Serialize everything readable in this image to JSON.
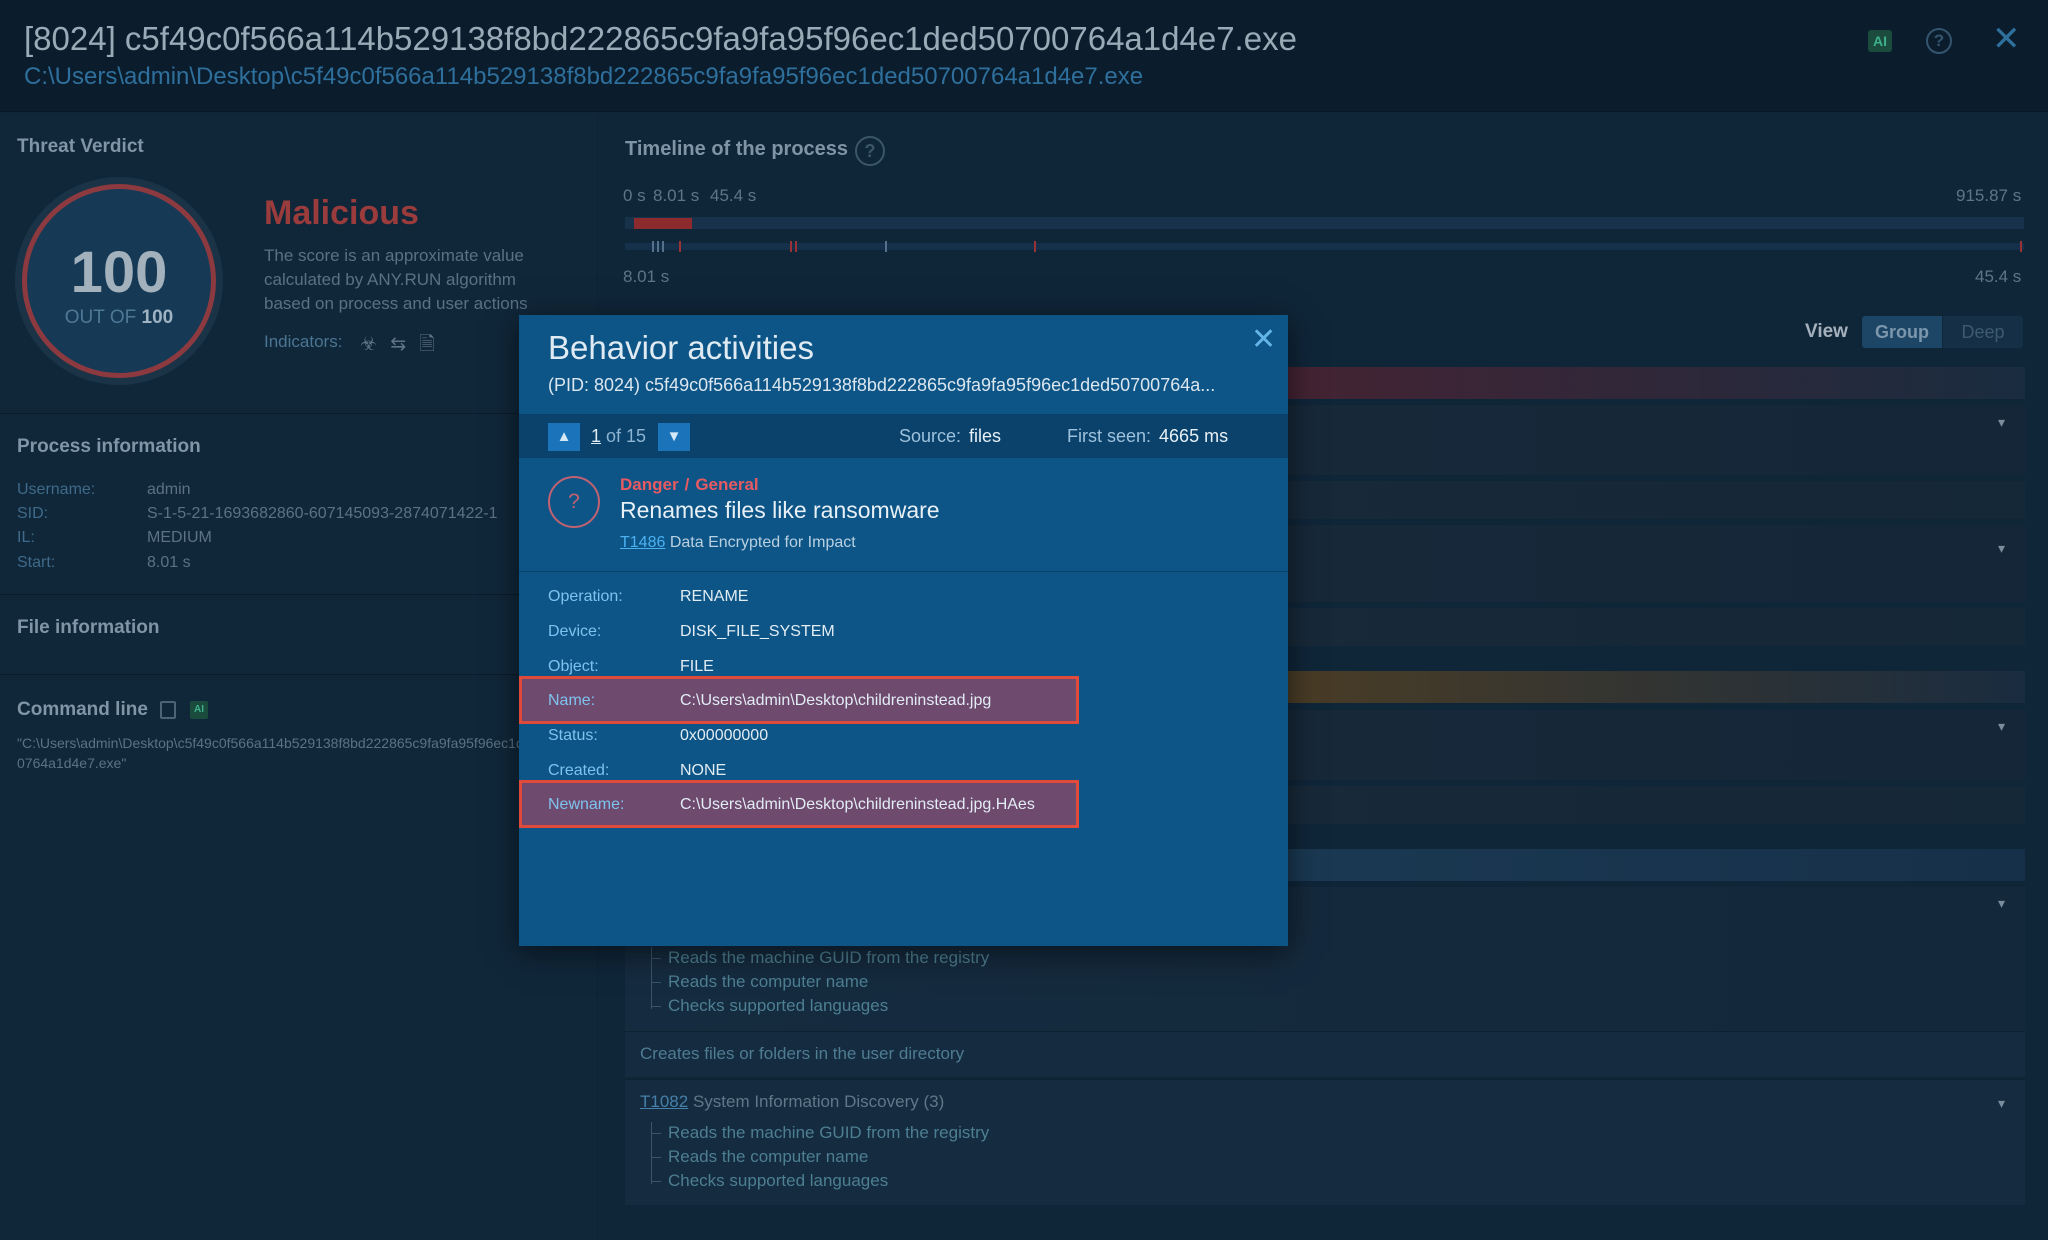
{
  "header": {
    "title": "[8024] c5f49c0f566a114b529138f8bd222865c9fa9fa95f96ec1ded50700764a1d4e7.exe",
    "path": "C:\\Users\\admin\\Desktop\\c5f49c0f566a114b529138f8bd222865c9fa9fa95f96ec1ded50700764a1d4e7.exe",
    "ai_badge": "AI",
    "help_icon": "question-circle-icon",
    "close_icon": "close-icon"
  },
  "verdict": {
    "section_title": "Threat Verdict",
    "score": "100",
    "out_of_label": "OUT OF",
    "out_of_value": "100",
    "label": "Malicious",
    "description": "The score is an approximate value calculated by ANY.RUN algorithm based on process and user actions",
    "indicators_label": "Indicators:",
    "indicator_icons": "☣ ⇆ 🗎",
    "label_color": "#9a3b3c"
  },
  "process_info": {
    "title": "Process information",
    "fields": [
      {
        "key": "Username:",
        "value": "admin"
      },
      {
        "key": "SID:",
        "value": "S-1-5-21-1693682860-607145093-2874071422-1"
      },
      {
        "key": "IL:",
        "value": "MEDIUM"
      },
      {
        "key": "Start:",
        "value": "8.01 s"
      }
    ]
  },
  "file_info": {
    "title": "File information"
  },
  "command_line": {
    "title": "Command line",
    "ai_badge": "AI",
    "value": "\"C:\\Users\\admin\\Desktop\\c5f49c0f566a114b529138f8bd222865c9fa9fa95f96ec1ded50700764a1d4e7.exe\""
  },
  "timeline": {
    "title": "Timeline of the process",
    "top_labels": [
      "0 s",
      "8.01 s",
      "45.4 s"
    ],
    "end_label": "915.87 s",
    "range_start": "8.01 s",
    "range_end": "45.4 s"
  },
  "view": {
    "label": "View",
    "group_label": "Group",
    "deep_label": "Deep"
  },
  "bg_list": {
    "items_a": [
      "Reads the machine GUID from the registry",
      "Reads the computer name",
      "Checks supported languages"
    ],
    "row_creates": "Creates files or folders in the user directory",
    "t1082_id": "T1082",
    "t1082_label": "System Information Discovery (3)",
    "items_b": [
      "Reads the machine GUID from the registry",
      "Reads the computer name",
      "Checks supported languages"
    ]
  },
  "modal": {
    "title": "Behavior activities",
    "subtitle": "(PID: 8024) c5f49c0f566a114b529138f8bd222865c9fa9fa95f96ec1ded50700764a...",
    "nav": {
      "current": "1",
      "of_label": "of 15",
      "source_key": "Source:",
      "source_value": "files",
      "first_seen_key": "First seen:",
      "first_seen_value": "4665 ms"
    },
    "detection": {
      "icon": "question-icon",
      "severity": "Danger",
      "separator": "/",
      "category": "General",
      "name": "Renames files like ransomware",
      "technique_id": "T1486",
      "technique_name": "Data Encrypted for Impact",
      "severity_color": "#e85a62"
    },
    "fields": [
      {
        "key": "Operation:",
        "value": "RENAME"
      },
      {
        "key": "Device:",
        "value": "DISK_FILE_SYSTEM"
      },
      {
        "key": "Object:",
        "value": "FILE"
      },
      {
        "key": "Name:",
        "value": "C:\\Users\\admin\\Desktop\\childreninstead.jpg"
      },
      {
        "key": "Status:",
        "value": "0x00000000"
      },
      {
        "key": "Created:",
        "value": "NONE"
      },
      {
        "key": "Newname:",
        "value": "C:\\Users\\admin\\Desktop\\childreninstead.jpg.HAes"
      }
    ]
  }
}
